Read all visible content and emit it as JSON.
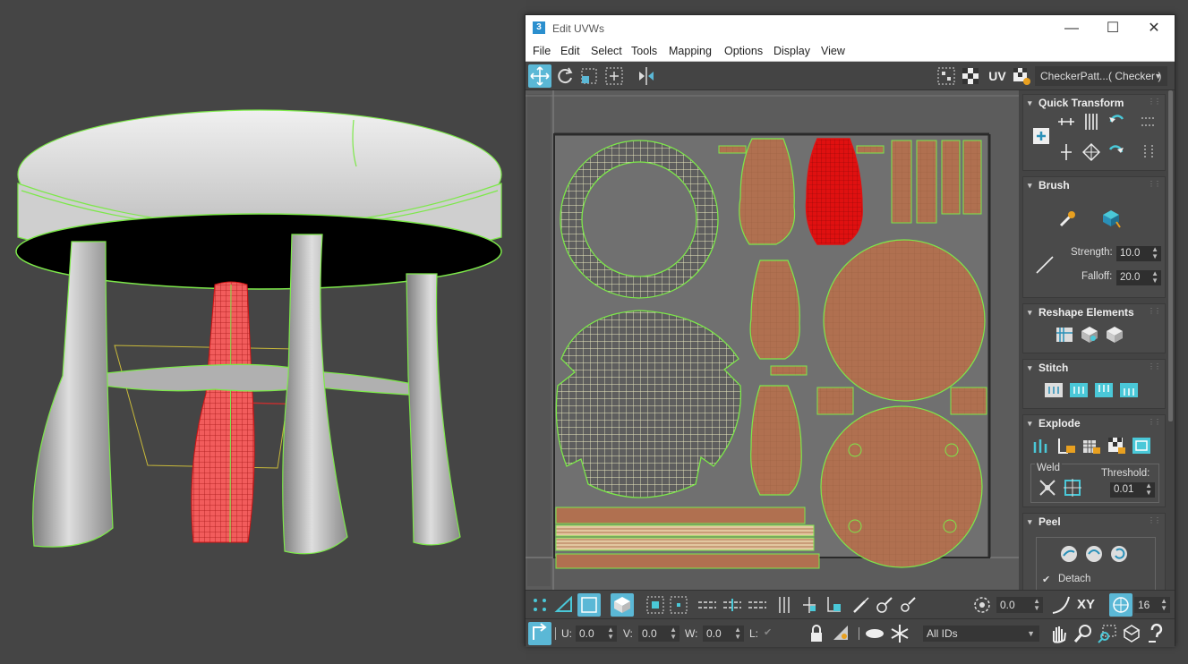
{
  "window": {
    "title": "Edit UVWs",
    "app_icon": "3",
    "controls": [
      "minimize-icon",
      "maximize-icon",
      "close-icon"
    ]
  },
  "menu": [
    "File",
    "Edit",
    "Select",
    "Tools",
    "Mapping",
    "Options",
    "Display",
    "View"
  ],
  "toolbar": {
    "uv_label": "UV",
    "texture_dropdown": "CheckerPatt...( Checker )"
  },
  "panel": {
    "quick_transform": {
      "title": "Quick Transform"
    },
    "brush": {
      "title": "Brush",
      "strength_label": "Strength:",
      "strength_value": "10.0",
      "falloff_label": "Falloff:",
      "falloff_value": "20.0"
    },
    "reshape": {
      "title": "Reshape Elements"
    },
    "stitch": {
      "title": "Stitch"
    },
    "explode": {
      "title": "Explode",
      "weld_label": "Weld",
      "threshold_label": "Threshold:",
      "threshold_value": "0.01"
    },
    "peel": {
      "title": "Peel",
      "detach_label": "Detach",
      "detach_checked": true
    }
  },
  "bottom_toolbar": {
    "angle_value": "0.0",
    "xy_label": "XY",
    "grid_value": "16",
    "u_label": "U:",
    "u_value": "0.0",
    "v_label": "V:",
    "v_value": "0.0",
    "w_label": "W:",
    "w_value": "0.0",
    "l_label": "L:",
    "ids_dropdown": "All IDs"
  },
  "colors": {
    "accent": "#5bb8d6",
    "selection": "#e01010",
    "uv_edge": "#7de84a",
    "uv_fill": "#b07050"
  }
}
